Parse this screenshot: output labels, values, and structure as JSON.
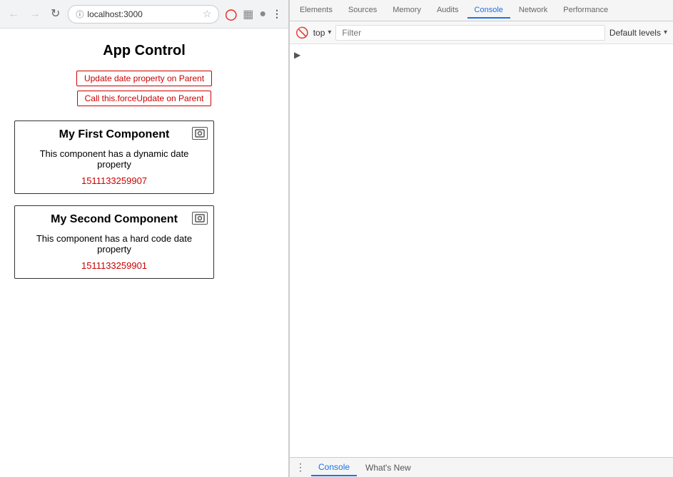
{
  "browser": {
    "back_disabled": true,
    "forward_disabled": true,
    "reload_label": "↻",
    "url": "localhost:3000",
    "star_label": "★",
    "opera_icon": "O",
    "extension_icon": "⊡",
    "github_icon": "⊙",
    "more_label": "⋮"
  },
  "page": {
    "title": "App Control",
    "buttons": [
      {
        "label": "Update date property on Parent"
      },
      {
        "label": "Call this.forceUpdate on Parent"
      }
    ],
    "components": [
      {
        "title": "My First Component",
        "description": "This component has a dynamic date property",
        "value": "1511133259907"
      },
      {
        "title": "My Second Component",
        "description": "This component has a hard code date property",
        "value": "1511133259901"
      }
    ]
  },
  "devtools": {
    "tabs": [
      {
        "label": "Elements",
        "active": false
      },
      {
        "label": "Sources",
        "active": false
      },
      {
        "label": "Memory",
        "active": false
      },
      {
        "label": "Audits",
        "active": false
      },
      {
        "label": "Console",
        "active": true
      },
      {
        "label": "Network",
        "active": false
      },
      {
        "label": "Performance",
        "active": false
      }
    ],
    "toolbar": {
      "no_entry": "🚫",
      "context": "top",
      "filter_placeholder": "Filter",
      "levels_label": "Default levels",
      "dropdown_arrow": "▾"
    },
    "bottom_tabs": [
      {
        "label": "Console",
        "active": true
      },
      {
        "label": "What's New",
        "active": false
      }
    ],
    "more_vert": "⋮"
  }
}
